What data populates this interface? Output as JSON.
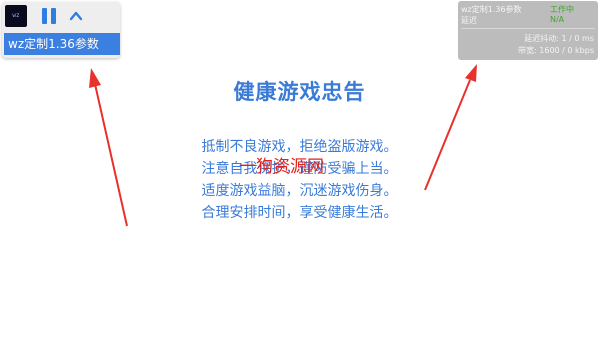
{
  "floating_toolbar": {
    "logo_text": "wz",
    "menu_item_label": "wz定制1.36参数"
  },
  "status_panel": {
    "app_label": "wz定制1.36参数",
    "state_value": "工作中",
    "latency_label": "延迟",
    "latency_value": "N/A",
    "jitter_text": "延迟抖动: 1 / 0 ms",
    "bandwidth_text": "带宽: 1600 / 0 kbps"
  },
  "notice": {
    "title": "健康游戏忠告",
    "lines": [
      "抵制不良游戏，拒绝盗版游戏。",
      "注意自我保护，谨防受骗上当。",
      "适度游戏益脑，沉迷游戏伤身。",
      "合理安排时间，享受健康生活。"
    ]
  },
  "watermark": {
    "text": "一狗资源网"
  },
  "colors": {
    "accent_blue": "#3a7bd8",
    "menu_blue": "#3b7fe0",
    "status_green": "#3fa52e",
    "arrow_red": "#e8312a",
    "watermark_red": "#e2211c",
    "panel_gray": "#bcbcbc"
  },
  "icons": {
    "pause": "pause-icon",
    "collapse": "chevron-up-icon",
    "logo": "app-logo-icon"
  }
}
